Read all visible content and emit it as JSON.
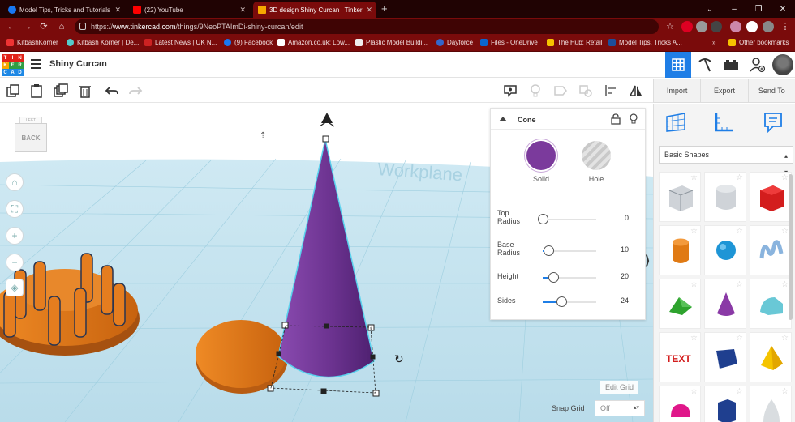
{
  "browser": {
    "tabs": [
      {
        "title": "Model Tips, Tricks and Tutorials",
        "icon": "facebook-icon",
        "color": "#1877f2"
      },
      {
        "title": "(22) YouTube",
        "icon": "youtube-icon",
        "color": "#ff0000"
      },
      {
        "title": "3D design Shiny Curcan | Tinker",
        "icon": "tinkercad-icon",
        "color": "#f6a800"
      }
    ],
    "new_tab": "+",
    "url_prefix": "https://",
    "url_host": "www.tinkercad.com",
    "url_path": "/things/9NeoPTAImDi-shiny-curcan/edit",
    "bookmarks": [
      {
        "label": "KitbashKorner",
        "color": "#e33"
      },
      {
        "label": "Kitbash Korner | De...",
        "color": "#5cc"
      },
      {
        "label": "Latest News | UK N...",
        "color": "#c22"
      },
      {
        "label": "(9) Facebook",
        "color": "#1877f2"
      },
      {
        "label": "Amazon.co.uk: Low...",
        "color": "#222"
      },
      {
        "label": "Plastic Model Buildi...",
        "color": "#333"
      },
      {
        "label": "Dayforce",
        "color": "#3366cc"
      },
      {
        "label": "Files - OneDrive",
        "color": "#0a66d0"
      },
      {
        "label": "The Hub: Retail",
        "color": "#333"
      },
      {
        "label": "Model Tips, Tricks A...",
        "color": "#1d4e9a"
      }
    ],
    "other_bookmarks": "Other bookmarks"
  },
  "app": {
    "logo_letters": [
      "T",
      "I",
      "N",
      "K",
      "E",
      "R",
      "C",
      "A",
      "D"
    ],
    "design_title": "Shiny Curcan",
    "side_tabs": [
      "Import",
      "Export",
      "Send To"
    ]
  },
  "viewcube": {
    "face": "BACK",
    "top": "LEFT"
  },
  "inspector": {
    "title": "Cone",
    "solid_label": "Solid",
    "hole_label": "Hole",
    "solid_color": "#7b3a9c",
    "params": [
      {
        "label": "Top Radius",
        "value": "0",
        "fraction": 0.0
      },
      {
        "label": "Base Radius",
        "value": "10",
        "fraction": 0.1
      },
      {
        "label": "Height",
        "value": "20",
        "fraction": 0.2
      },
      {
        "label": "Sides",
        "value": "24",
        "fraction": 0.35
      }
    ]
  },
  "library": {
    "selected": "Basic Shapes",
    "shapes": [
      "Box",
      "Cylinder",
      "Box",
      "Cylinder",
      "Sphere",
      "Scribble",
      "Roof",
      "Cone",
      "Round Roof",
      "Text",
      "Wedge",
      "Pyramid",
      "Half Sphere",
      "Polygon",
      "Paraboloid"
    ]
  },
  "workplane": {
    "edit_grid": "Edit Grid",
    "snap_grid_label": "Snap Grid",
    "snap_grid_value": "Off"
  }
}
